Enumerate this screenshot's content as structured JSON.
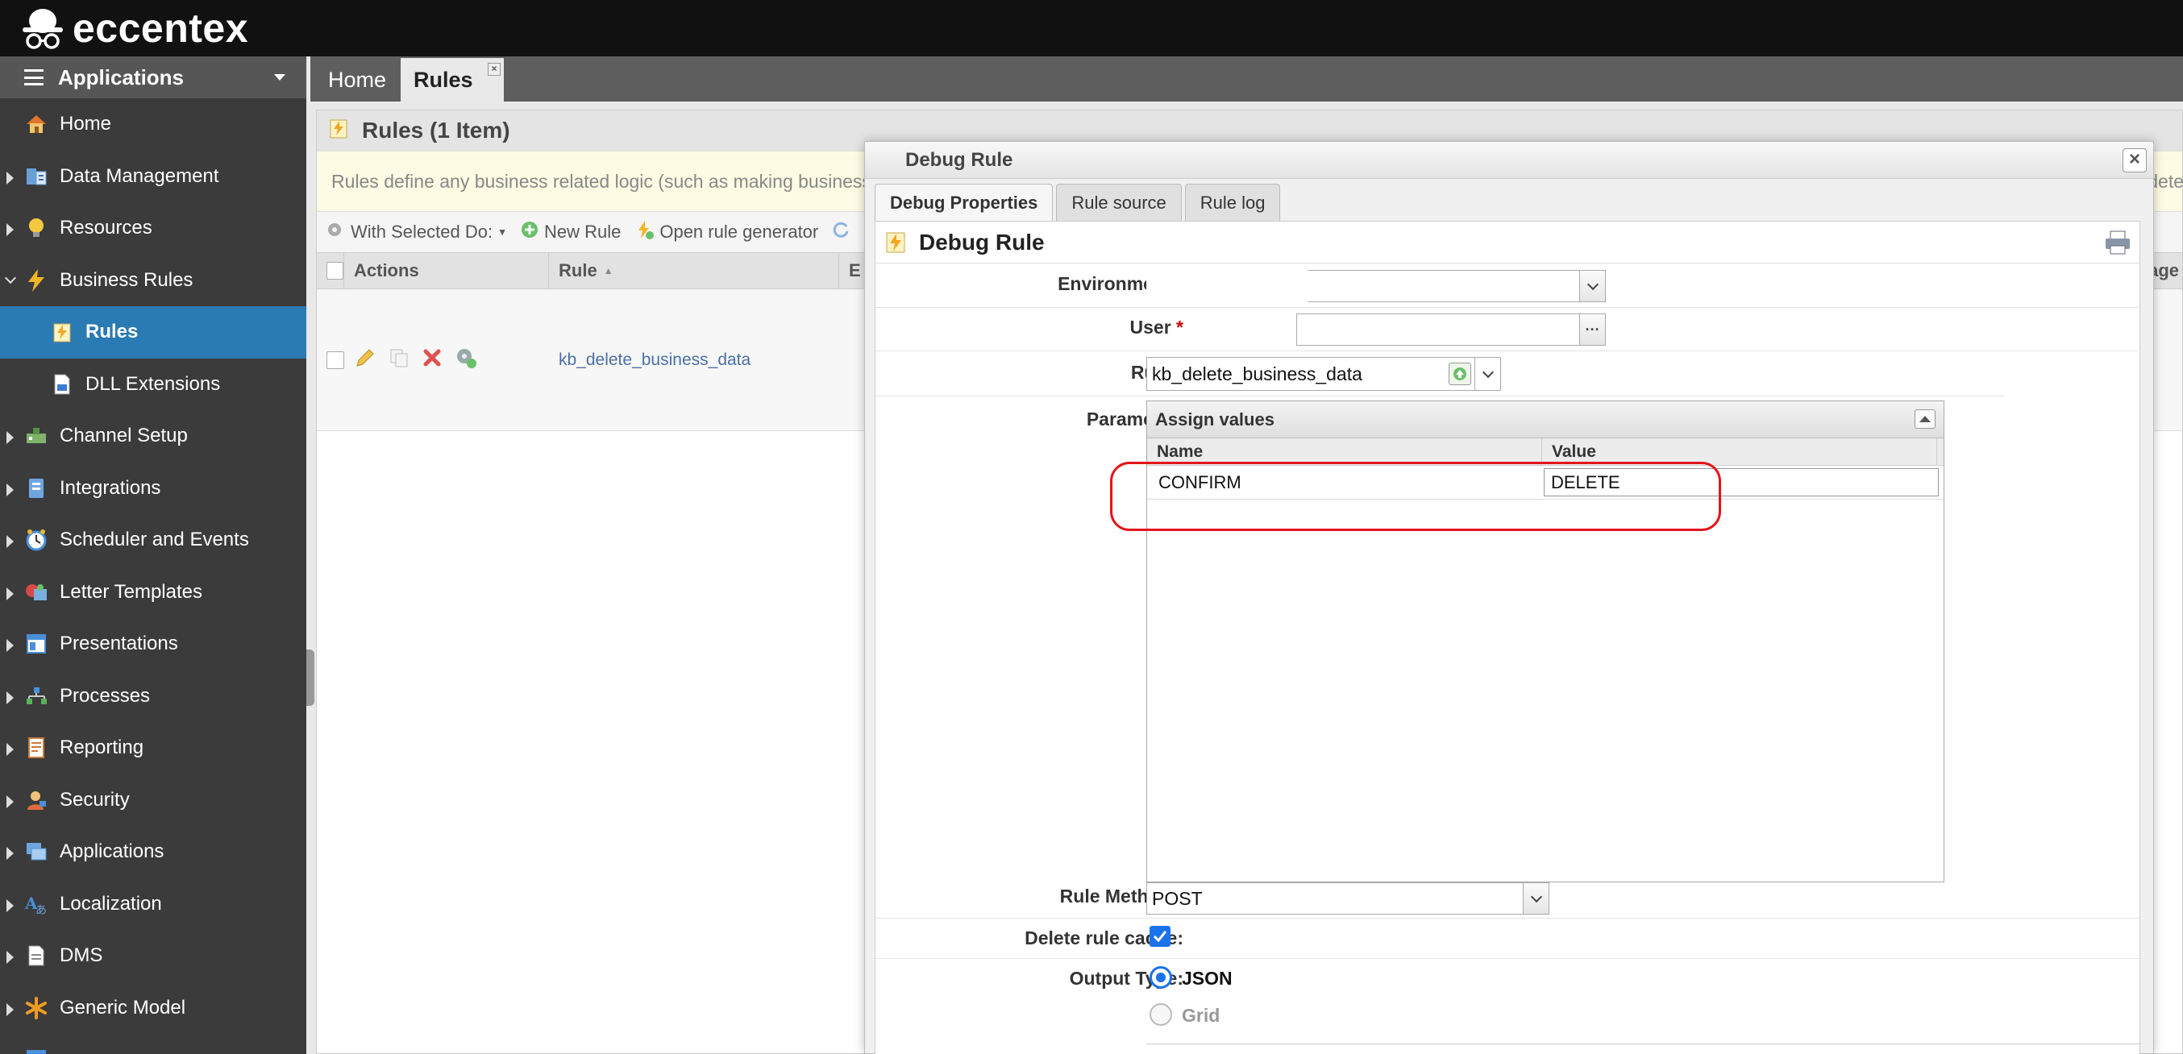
{
  "brand": {
    "name": "eccentex"
  },
  "sidebar": {
    "header": "Applications",
    "items": [
      {
        "label": "Home",
        "icon": "house-icon"
      },
      {
        "label": "Data Management",
        "icon": "database-icon"
      },
      {
        "label": "Resources",
        "icon": "lightbulb-icon"
      },
      {
        "label": "Business Rules",
        "icon": "lightning-icon"
      },
      {
        "label": "Rules",
        "icon": "rule-lightning-icon"
      },
      {
        "label": "DLL Extensions",
        "icon": "dll-file-icon"
      },
      {
        "label": "Channel Setup",
        "icon": "channel-icon"
      },
      {
        "label": "Integrations",
        "icon": "integration-icon"
      },
      {
        "label": "Scheduler and Events",
        "icon": "clock-icon"
      },
      {
        "label": "Letter Templates",
        "icon": "letter-icon"
      },
      {
        "label": "Presentations",
        "icon": "presentation-icon"
      },
      {
        "label": "Processes",
        "icon": "process-icon"
      },
      {
        "label": "Reporting",
        "icon": "report-icon"
      },
      {
        "label": "Security",
        "icon": "user-security-icon"
      },
      {
        "label": "Applications",
        "icon": "applications-icon"
      },
      {
        "label": "Localization",
        "icon": "localization-icon"
      },
      {
        "label": "DMS",
        "icon": "dms-icon"
      },
      {
        "label": "Generic Model",
        "icon": "asterisk-icon"
      }
    ]
  },
  "tabs": [
    {
      "label": "Home"
    },
    {
      "label": "Rules",
      "close": "×"
    }
  ],
  "panel": {
    "title": "Rules (1 Item)",
    "info": "Rules define any business related logic (such as making business de",
    "info_tail": "dete",
    "toolbar": {
      "with_selected": "With Selected Do:",
      "new_rule": "New Rule",
      "open_generator": "Open rule generator"
    },
    "columns": {
      "actions": "Actions",
      "rule": "Rule",
      "third": "E",
      "right": "age"
    },
    "rows": [
      {
        "rule": "kb_delete_business_data"
      }
    ]
  },
  "dialog": {
    "title": "Debug Rule",
    "close": "×",
    "tabs": [
      "Debug Properties",
      "Rule source",
      "Rule log"
    ],
    "body_title": "Debug Rule",
    "fields": {
      "environment_label": "Environment",
      "user_label": "User",
      "user_btn": "···",
      "rule_label": "Rule",
      "rule_value": "kb_delete_business_data",
      "parameter_label": "Parameter:",
      "rule_method_label": "Rule Method",
      "rule_method_value": "POST",
      "delete_cache_label": "Delete rule cache:",
      "delete_cache_checked": true,
      "output_type_label": "Output Type:",
      "output_json": "JSON",
      "output_grid": "Grid"
    },
    "required_mark": "*",
    "assign": {
      "title": "Assign values",
      "col_name": "Name",
      "col_value": "Value",
      "rows": [
        {
          "name": "CONFIRM",
          "value": "DELETE"
        }
      ]
    }
  }
}
